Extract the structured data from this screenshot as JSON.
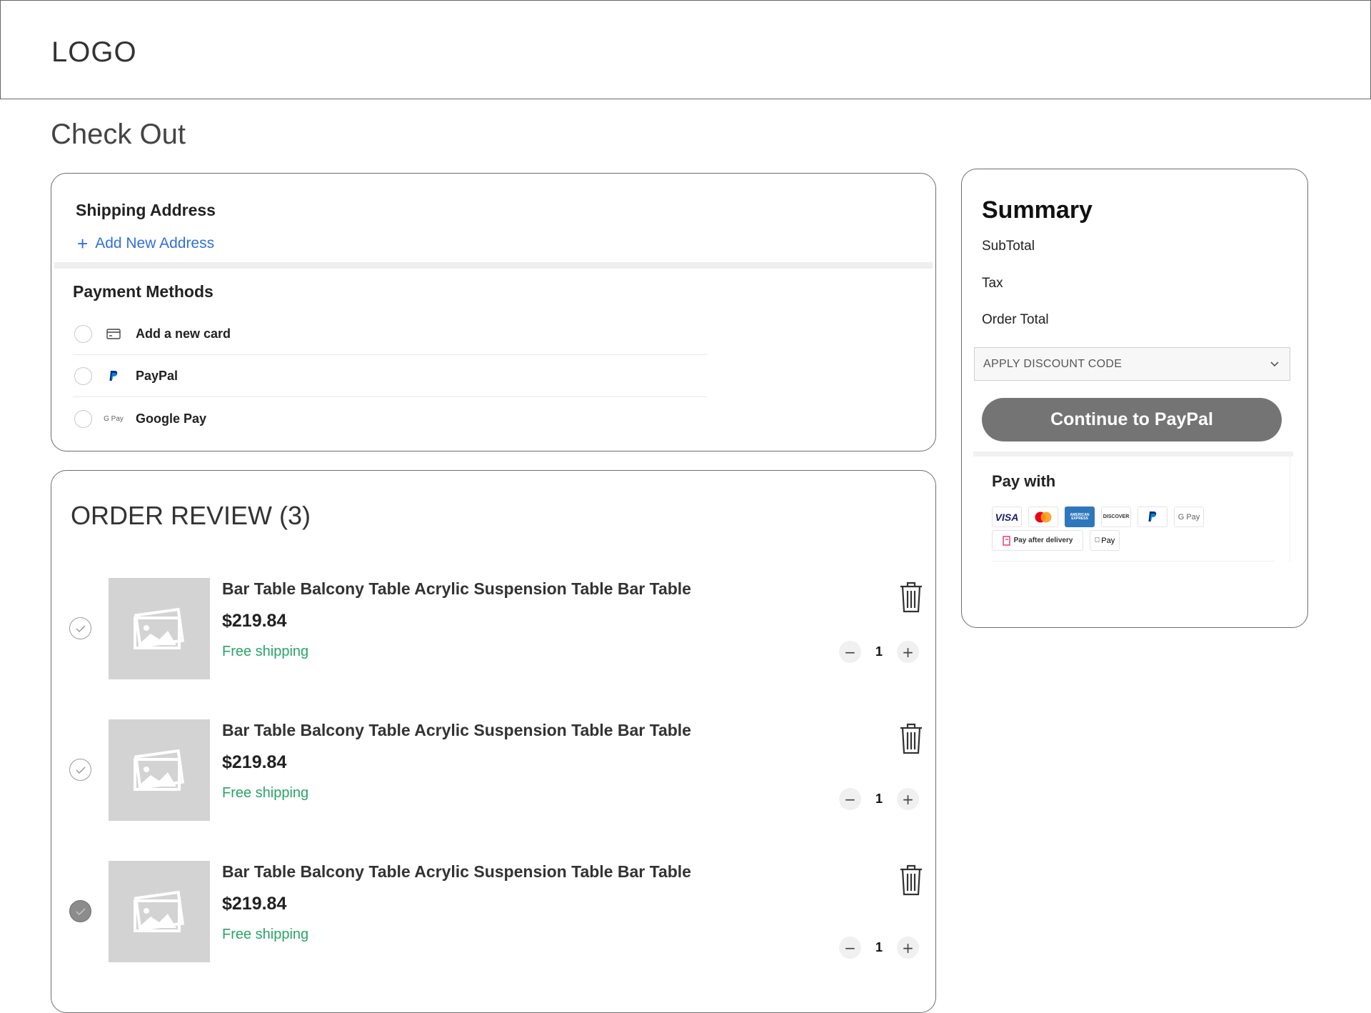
{
  "header": {
    "logo": "LOGO"
  },
  "page": {
    "title": "Check Out"
  },
  "shipping": {
    "heading": "Shipping Address",
    "add_address": "Add New Address",
    "add_icon": "plus-icon"
  },
  "payment": {
    "heading": "Payment Methods",
    "methods": [
      {
        "label": "Add a new card",
        "icon": "credit-card-icon"
      },
      {
        "label": "PayPal",
        "icon": "paypal-icon"
      },
      {
        "label": "Google Pay",
        "icon": "google-pay-icon",
        "icon_text": "G Pay"
      }
    ]
  },
  "summary": {
    "title": "Summary",
    "subtotal_label": "SubTotal",
    "tax_label": "Tax",
    "order_total_label": "Order Total",
    "discount_placeholder": "APPLY DISCOUNT CODE",
    "continue_label": "Continue to PayPal",
    "pay_with_title": "Pay with",
    "pay_logos": [
      {
        "name": "visa",
        "text": "VISA",
        "color": "#1a1f71"
      },
      {
        "name": "mastercard",
        "text": "",
        "color": "#eb001b"
      },
      {
        "name": "amex",
        "text": "AMERICAN EXPRESS",
        "color": "#2e77bc"
      },
      {
        "name": "discover",
        "text": "DISCOVER",
        "color": "#f58220"
      },
      {
        "name": "paypal",
        "text": "P",
        "color": "#003087"
      },
      {
        "name": "google-pay",
        "text": "G Pay",
        "color": "#5f6368"
      }
    ],
    "pay_logos_2": [
      {
        "name": "pay-after-delivery",
        "text": "Pay after delivery",
        "color": "#e0245e"
      },
      {
        "name": "apple-pay",
        "text": "Pay",
        "color": "#000000"
      }
    ]
  },
  "order_review": {
    "title": "ORDER REVIEW (3)",
    "items": [
      {
        "name": "Bar Table Balcony Table Acrylic Suspension Table Bar Table",
        "price": "$219.84",
        "shipping": "Free shipping",
        "qty": "1",
        "checked": false
      },
      {
        "name": "Bar Table Balcony Table Acrylic Suspension Table Bar Table",
        "price": "$219.84",
        "shipping": "Free shipping",
        "qty": "1",
        "checked": false
      },
      {
        "name": "Bar Table Balcony Table Acrylic Suspension Table Bar Table",
        "price": "$219.84",
        "shipping": "Free shipping",
        "qty": "1",
        "checked": true
      }
    ],
    "qty_minus": "−",
    "qty_plus": "+"
  },
  "colors": {
    "accent_link": "#2f6fe0",
    "free_shipping": "#2aa36a",
    "button_gray": "#747474"
  }
}
